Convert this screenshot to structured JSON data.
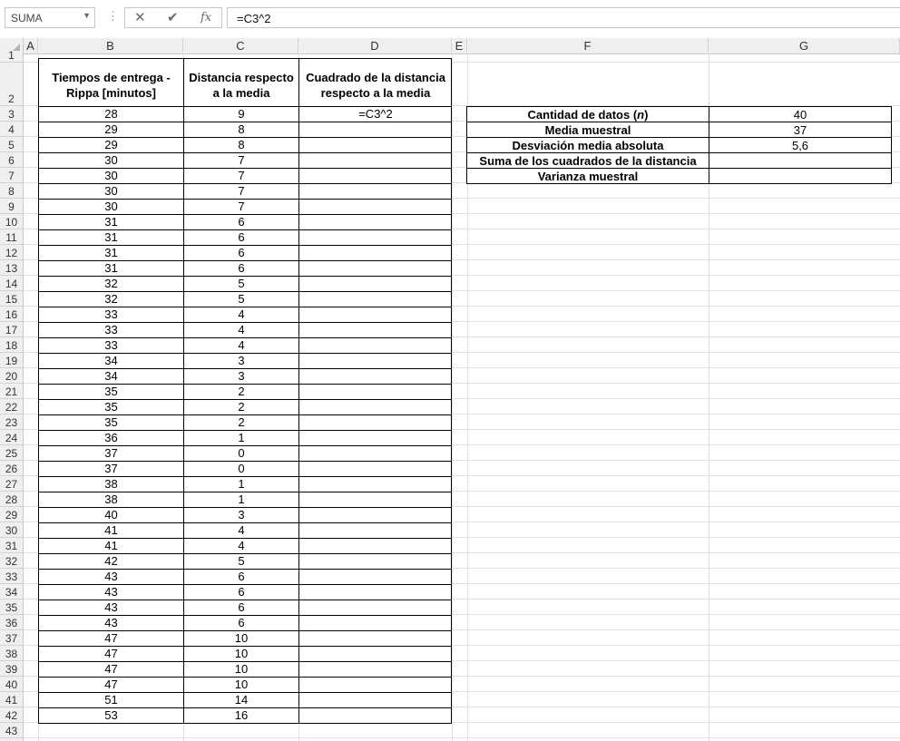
{
  "formula_bar": {
    "name_box": "SUMA",
    "cancel_icon": "✕",
    "enter_icon": "✔",
    "fx_label": "fx",
    "formula": "=C3^2"
  },
  "columns": [
    "A",
    "B",
    "C",
    "D",
    "E",
    "F",
    "G"
  ],
  "rows": [
    "1",
    "2",
    "3",
    "4",
    "5",
    "6",
    "7",
    "8",
    "9",
    "10",
    "11",
    "12",
    "13",
    "14",
    "15",
    "16",
    "17",
    "18",
    "19",
    "20",
    "21",
    "22",
    "23",
    "24",
    "25",
    "26",
    "27",
    "28",
    "29",
    "30",
    "31",
    "32",
    "33",
    "34",
    "35",
    "36",
    "37",
    "38",
    "39",
    "40",
    "41",
    "42",
    "43"
  ],
  "data_table": {
    "headers": {
      "b": "Tiempos de entrega - Rippa [minutos]",
      "c": "Distancia respecto a la media",
      "d": "Cuadrado de la distancia respecto a la media"
    },
    "times": [
      "28",
      "29",
      "29",
      "30",
      "30",
      "30",
      "30",
      "31",
      "31",
      "31",
      "31",
      "32",
      "32",
      "33",
      "33",
      "33",
      "34",
      "34",
      "35",
      "35",
      "35",
      "36",
      "37",
      "37",
      "38",
      "38",
      "40",
      "41",
      "41",
      "42",
      "43",
      "43",
      "43",
      "43",
      "47",
      "47",
      "47",
      "47",
      "51",
      "53"
    ],
    "distances": [
      "9",
      "8",
      "8",
      "7",
      "7",
      "7",
      "7",
      "6",
      "6",
      "6",
      "6",
      "5",
      "5",
      "4",
      "4",
      "4",
      "3",
      "3",
      "2",
      "2",
      "2",
      "1",
      "0",
      "0",
      "1",
      "1",
      "3",
      "4",
      "4",
      "5",
      "6",
      "6",
      "6",
      "6",
      "10",
      "10",
      "10",
      "10",
      "14",
      "16"
    ],
    "d3_editing": "=C3^2"
  },
  "summary_table": {
    "rows": [
      {
        "label_pre": "Cantidad de datos (",
        "label_italic": "n",
        "label_post": ")",
        "value": "40"
      },
      {
        "label_pre": "Media muestral",
        "label_italic": "",
        "label_post": "",
        "value": "37"
      },
      {
        "label_pre": "Desviación media absoluta",
        "label_italic": "",
        "label_post": "",
        "value": "5,6"
      },
      {
        "label_pre": "Suma de los cuadrados de la distancia",
        "label_italic": "",
        "label_post": "",
        "value": ""
      },
      {
        "label_pre": "Varianza muestral",
        "label_italic": "",
        "label_post": "",
        "value": ""
      }
    ]
  }
}
